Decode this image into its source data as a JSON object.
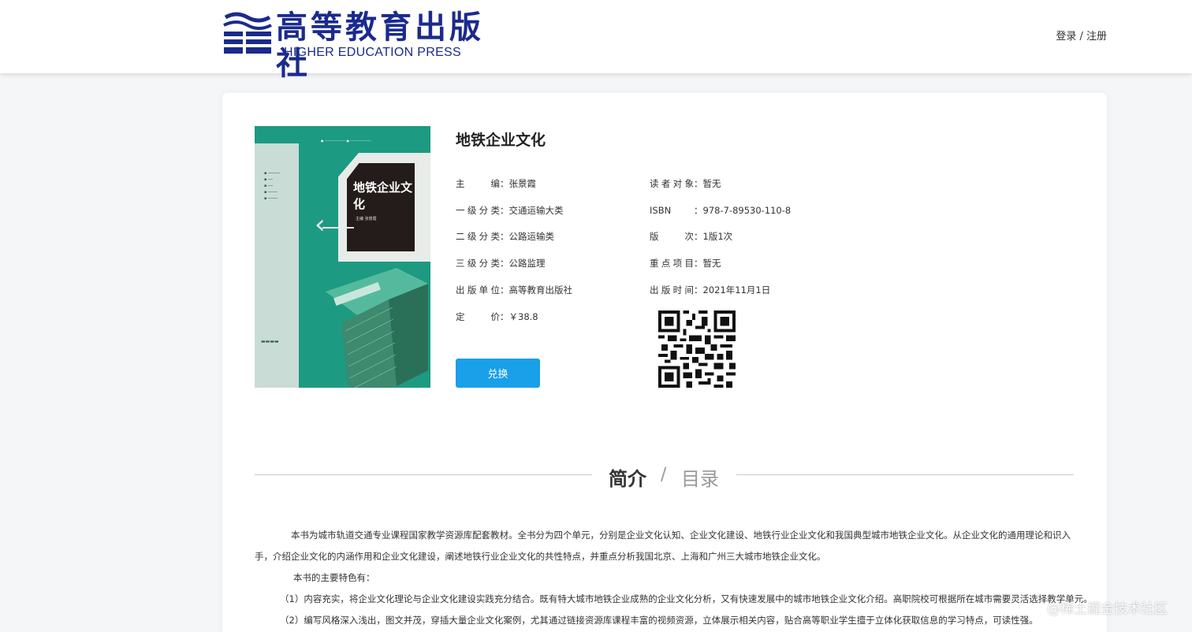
{
  "header": {
    "logo_cn": "高等教育出版社",
    "logo_en": "HIGHER EDUCATION PRESS",
    "auth_link": "登录 / 注册"
  },
  "cover": {
    "title": "地铁企业文化",
    "author": "主编 张景霞"
  },
  "book": {
    "title": "地铁企业文化",
    "left_fields": [
      {
        "label": "主编",
        "value": "张景霞"
      },
      {
        "label": "一级分类",
        "value": "交通运输大类"
      },
      {
        "label": "二级分类",
        "value": "公路运输类"
      },
      {
        "label": "三级分类",
        "value": "公路监理"
      },
      {
        "label": "出版单位",
        "value": "高等教育出版社"
      },
      {
        "label": "定价",
        "value": "￥38.8"
      }
    ],
    "right_fields": [
      {
        "label": "读者对象",
        "value": "暂无"
      },
      {
        "label": "ISBN",
        "value": "978-7-89530-110-8"
      },
      {
        "label": "版次",
        "value": "1版1次"
      },
      {
        "label": "重点项目",
        "value": "暂无"
      },
      {
        "label": "出版时间",
        "value": "2021年11月1日"
      }
    ],
    "redeem_label": "兑换"
  },
  "tabs": {
    "intro": "简介",
    "separator": "/",
    "toc": "目录"
  },
  "description": {
    "p1": "本书为城市轨道交通专业课程国家教学资源库配套教材。全书分为四个单元，分别是企业文化认知、企业文化建设、地铁行业企业文化和我国典型城市地铁企业文化。从企业文化的通用理论和识入手，介绍企业文化的内涵作用和企业文化建设，阐述地铁行业企业文化的共性特点，并重点分析我国北京、上海和广州三大城市地铁企业文化。",
    "p2": "本书的主要特色有：",
    "p3": "（1）内容充实，将企业文化理论与企业文化建设实践充分结合。既有特大城市地铁企业成熟的企业文化分析，又有快速发展中的城市地铁企业文化介绍。高职院校可根据所在城市需要灵活选择教学单元。",
    "p4": "（2）编写风格深入浅出，图文并茂，穿插大量企业文化案例，尤其通过链接资源库课程丰富的视频资源，立体展示相关内容，贴合高等职业学生擅于立体化获取信息的学习特点，可读性强。"
  },
  "watermark": "@稀土掘金技术社区"
}
